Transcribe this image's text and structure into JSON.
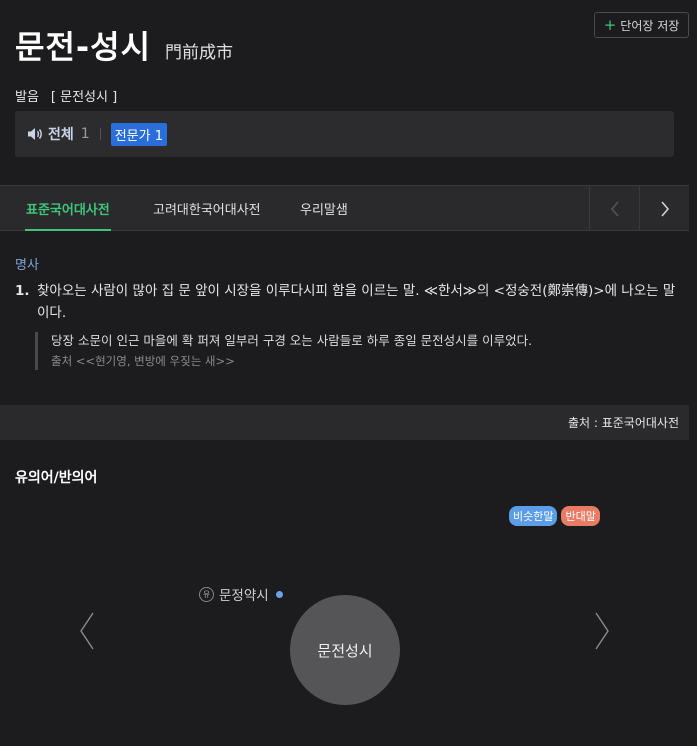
{
  "header": {
    "word": "문전-성시",
    "hanja": "門前成市",
    "save_label": "단어장 저장",
    "save_icon": "plus-icon"
  },
  "pronunciation": {
    "label": "발음",
    "value": "[ 문전성시 ]"
  },
  "audio": {
    "all_label": "전체",
    "all_count": "1",
    "expert_label": "전문가 1"
  },
  "tabs": [
    {
      "label": "표준국어대사전",
      "active": true
    },
    {
      "label": "고려대한국어대사전",
      "active": false
    },
    {
      "label": "우리말샘",
      "active": false
    }
  ],
  "definition": {
    "pos": "명사",
    "number": "1.",
    "text": "찾아오는 사람이 많아 집 문 앞이 시장을 이루다시피 함을 이르는 말. ≪한서≫의 <정숭전(鄭崇傳)>에 나오는 말이다.",
    "example": "당장 소문이 인근 마을에 확 퍼져 일부러 구경 오는 사람들로 하루 종일 문전성시를 이루었다.",
    "example_source": "출처 <<현기영, 변방에 우짖는 새>>"
  },
  "source_bar": "출처 : 표준국어대사전",
  "synonyms": {
    "title": "유의어/반의어",
    "legend_similar": "비슷한말",
    "legend_opposite": "반대말",
    "related_word": "문정약시",
    "related_icon_text": "유",
    "center_word": "문전성시",
    "colors": {
      "similar": "#5b9de6",
      "opposite": "#e87b64"
    }
  }
}
